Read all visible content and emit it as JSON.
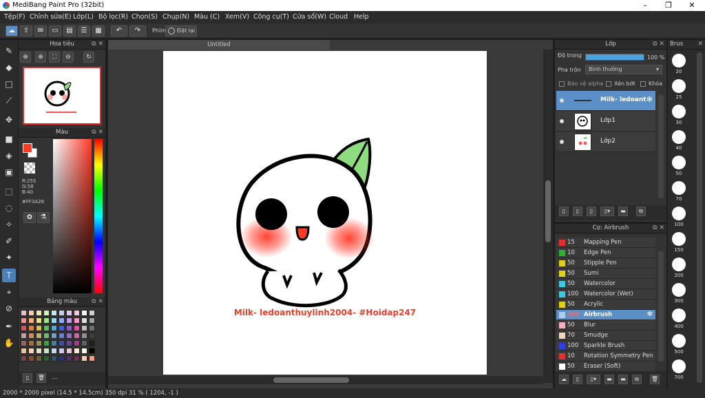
{
  "window": {
    "title": "MediBang Paint Pro (32bit)"
  },
  "menu": [
    "Tệp(F)",
    "Chỉnh sửa(E)",
    "Lớp(L)",
    "Bộ lọc(R)",
    "Chọn(S)",
    "Chụp(N)",
    "Màu (C)",
    "Xem(V)",
    "Công cụ(T)",
    "Cửa sổ(W)",
    "Cloud",
    "Help"
  ],
  "toolbar": {
    "key_label": "Phím",
    "reset_label": "Đặt lại"
  },
  "navigator": {
    "title": "Hoa tiêu"
  },
  "color": {
    "title": "Màu",
    "r": "R:255",
    "g": "G:58",
    "b": "B:40",
    "hex": "#FF3A28",
    "fg": "#FF3A28"
  },
  "palette": {
    "title": "Bảng màu",
    "footer": "---"
  },
  "document": {
    "tab": "Untitled",
    "caption": "Milk- ledoanthuylinh2004- #Hoidap247"
  },
  "layers": {
    "title": "Lớp",
    "opacity_label": "Độ trong",
    "opacity_value": "100 %",
    "opacity": 1.0,
    "blend_label": "Pha trộn",
    "blend_value": "Bình thường",
    "protect_alpha": "Bảo vệ alpha",
    "clipping": "Xén bớt",
    "lock": "Khóa",
    "items": [
      {
        "name": "Milk- ledoant",
        "selected": true
      },
      {
        "name": "Lớp1",
        "selected": false
      },
      {
        "name": "Lớp2",
        "selected": false
      }
    ]
  },
  "brushes": {
    "title": "Cọ: Airbrush",
    "items": [
      {
        "size": "15",
        "name": "Mapping Pen",
        "color": "#e03030"
      },
      {
        "size": "10",
        "name": "Edge Pen",
        "color": "#30b030"
      },
      {
        "size": "50",
        "name": "Stipple Pen",
        "color": "#e0d020"
      },
      {
        "size": "50",
        "name": "Sumi",
        "color": "#e0d020"
      },
      {
        "size": "50",
        "name": "Watercolor",
        "color": "#40c8e0"
      },
      {
        "size": "100",
        "name": "Watercolor (Wet)",
        "color": "#40c8e0"
      },
      {
        "size": "50",
        "name": "Acrylic",
        "color": "#e0d020"
      },
      {
        "size": "300",
        "name": "Airbrush",
        "color": "#aaccee",
        "selected": true
      },
      {
        "size": "50",
        "name": "Blur",
        "color": "#f0b0c0"
      },
      {
        "size": "70",
        "name": "Smudge",
        "color": "#f0d8c0"
      },
      {
        "size": "100",
        "name": "Sparkle Brush",
        "color": "#3040e0"
      },
      {
        "size": "10",
        "name": "Rotation Symmetry Pen",
        "color": "#e03030"
      },
      {
        "size": "50",
        "name": "Eraser (Soft)",
        "color": "#ffffff"
      }
    ]
  },
  "brush_sizes": {
    "title": "Brus",
    "values": [
      "20",
      "25",
      "30",
      "40",
      "50",
      "70",
      "100",
      "150",
      "200",
      "300",
      "400",
      "500",
      "700"
    ]
  },
  "status": {
    "text": "2000 * 2000 pixel   (14.5 * 14.5cm)   350 dpi   31 %   ( 1204, -1 )"
  }
}
